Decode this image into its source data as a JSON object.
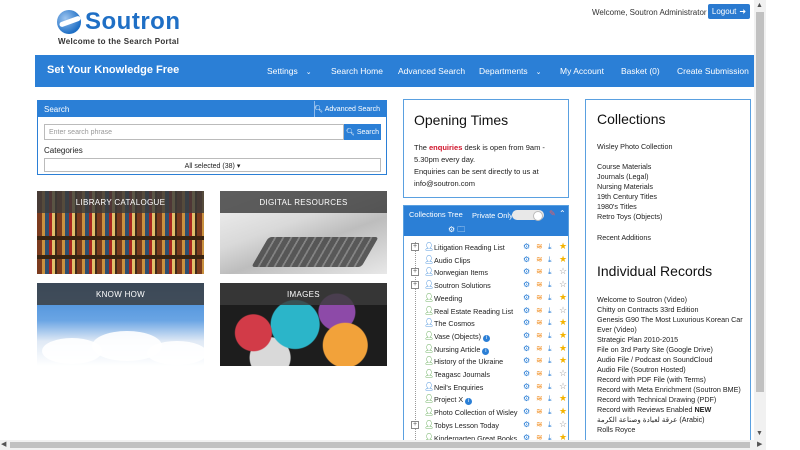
{
  "header": {
    "logo_text": "Soutron",
    "tagline": "Welcome to the Search Portal",
    "welcome": "Welcome, Soutron Administrator",
    "logout_label": "Logout"
  },
  "nav": {
    "brand": "Set Your Knowledge Free",
    "items": [
      {
        "label": "Settings",
        "dropdown": true
      },
      {
        "label": "Search Home",
        "dropdown": false
      },
      {
        "label": "Advanced Search",
        "dropdown": false
      },
      {
        "label": "Departments",
        "dropdown": true
      },
      {
        "label": "My Account",
        "dropdown": false
      },
      {
        "label": "Basket (0)",
        "dropdown": false
      },
      {
        "label": "Create Submission",
        "dropdown": false
      }
    ]
  },
  "search": {
    "title": "Search",
    "advanced_label": "Advanced Search",
    "placeholder": "Enter search phrase",
    "button_label": "Search",
    "categories_label": "Categories",
    "categories_value": "All selected (38)"
  },
  "tiles": {
    "library": "LIBRARY CATALOGUE",
    "digital": "DIGITAL RESOURCES",
    "knowhow": "KNOW HOW",
    "images": "IMAGES"
  },
  "opening": {
    "title": "Opening Times",
    "text_pre": "The ",
    "text_highlight": "enquiries",
    "text_post": " desk is open from 9am - 5.30pm every day.",
    "text_line2": "Enquiries can be sent directly to us at",
    "email": "info@soutron.com"
  },
  "tree": {
    "title": "Collections Tree",
    "private_label": "Private Only",
    "items": [
      {
        "label": "Litigation Reading List",
        "person": "blue",
        "plus": true,
        "info": false,
        "star": true
      },
      {
        "label": "Audio Clips",
        "person": "blue",
        "plus": false,
        "info": false,
        "star": true
      },
      {
        "label": "Norwegian Items",
        "person": "blue",
        "plus": true,
        "info": false,
        "star": false
      },
      {
        "label": "Soutron Solutions",
        "person": "blue",
        "plus": true,
        "info": false,
        "star": false
      },
      {
        "label": "Weeding",
        "person": "green",
        "plus": false,
        "info": false,
        "star": true
      },
      {
        "label": "Real Estate Reading List",
        "person": "green",
        "plus": false,
        "info": false,
        "star": false
      },
      {
        "label": "The Cosmos",
        "person": "blue",
        "plus": false,
        "info": false,
        "star": true
      },
      {
        "label": "Vase (Objects)",
        "person": "green",
        "plus": false,
        "info": true,
        "star": true
      },
      {
        "label": "Nursing Article",
        "person": "green",
        "plus": false,
        "info": true,
        "star": true
      },
      {
        "label": "History of the Ukraine",
        "person": "green",
        "plus": false,
        "info": false,
        "star": true
      },
      {
        "label": "Teagasc Journals",
        "person": "green",
        "plus": false,
        "info": false,
        "star": false
      },
      {
        "label": "Neil's Enquiries",
        "person": "blue",
        "plus": false,
        "info": false,
        "star": false
      },
      {
        "label": "Project X",
        "person": "green",
        "plus": false,
        "info": true,
        "star": true
      },
      {
        "label": "Photo Collection of Wisley",
        "person": "green",
        "plus": false,
        "info": false,
        "star": true
      },
      {
        "label": "Tobys Lesson Today",
        "person": "green",
        "plus": true,
        "info": false,
        "star": false
      },
      {
        "label": "Kindergarten Great Books",
        "person": "green",
        "plus": false,
        "info": false,
        "star": true
      }
    ]
  },
  "collections": {
    "title": "Collections",
    "items": [
      "Wisley Photo Collection",
      "Course Materials",
      "Journals (Legal)",
      "Nursing Materials",
      "19th Century Titles",
      "1980's Titles",
      "Retro Toys (Objects)",
      "Recent Additions"
    ]
  },
  "records": {
    "title": "Individual Records",
    "items": [
      "Welcome to Soutron (Video)",
      "Chitty on Contracts 33rd Edition",
      "Genesis G90 The Most Luxurious Korean Car",
      "Ever (Video)",
      "Strategic Plan 2010-2015",
      "File on 3rd Party Site (Google Drive)",
      "Audio File / Podcast on SoundCloud",
      "Audio File (Soutron Hosted)",
      "Record with PDF File (with Terms)",
      "Record with Meta Enrichment (Soutron BME)",
      "Record with Technical Drawing (PDF)",
      "Record with Reviews Enabled",
      "عرقة لعيادة وصناعة الكرمة (Arabic)",
      "Rolls Royce"
    ],
    "new_badge": "NEW"
  },
  "colors": {
    "brand_blue": "#2b7fd6",
    "star_gold": "#f4b400",
    "enquiries_red": "#d0132a"
  }
}
